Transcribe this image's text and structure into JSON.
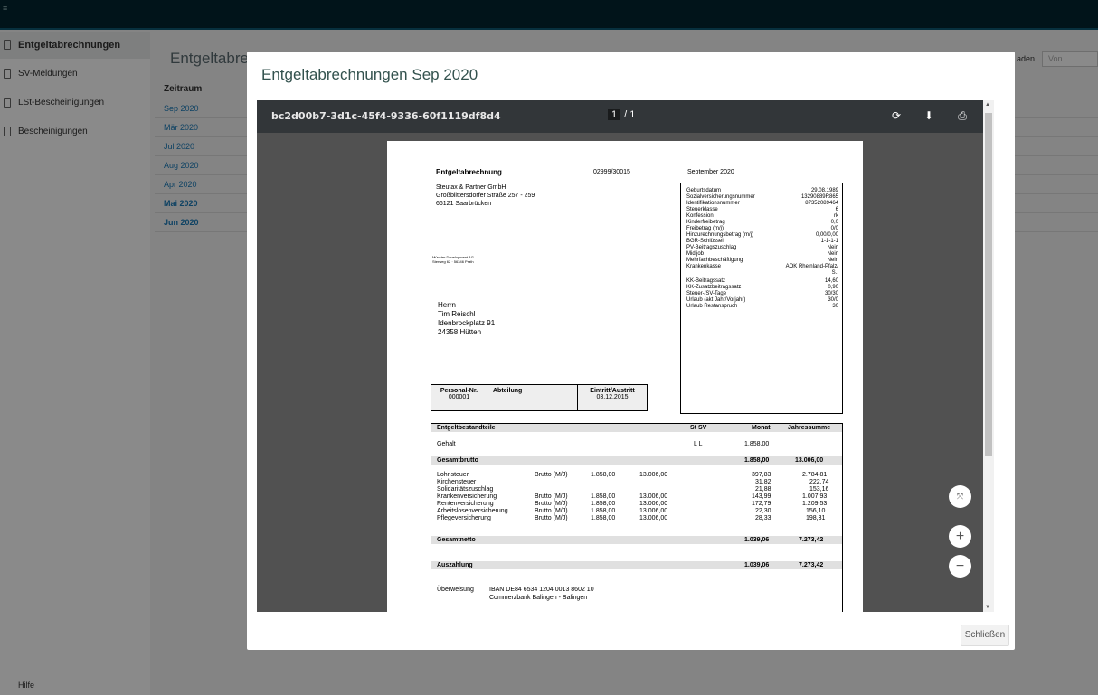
{
  "sidebar": {
    "items": [
      {
        "label": "Entgeltabrechnungen"
      },
      {
        "label": "SV-Meldungen"
      },
      {
        "label": "LSt-Bescheinigungen"
      },
      {
        "label": "Bescheinigungen"
      }
    ],
    "help_label": "Hilfe"
  },
  "main": {
    "title": "Entgeltabrec",
    "column_header": "Zeitraum",
    "rows": [
      "Sep 2020",
      "Mär 2020",
      "Jul 2020",
      "Aug 2020",
      "Apr 2020",
      "Mai 2020",
      "Jun 2020"
    ],
    "filter_label": "aden",
    "filter_placeholder": "Von"
  },
  "modal": {
    "title": "Entgeltabrechnungen Sep 2020",
    "close_label": "Schließen",
    "viewer": {
      "filename": "bc2d00b7-3d1c-45f4-9336-60f1119df8d4",
      "page_current": "1",
      "page_total": "/ 1"
    }
  },
  "document": {
    "title": "Entgeltabrechnung",
    "number": "02999/30015",
    "period": "September 2020",
    "employer": [
      "Steutax & Partner GmbH",
      "Großblittersdorfer Straße 257 - 259",
      "66121 Saarbrücken"
    ],
    "sender": [
      "Münster Development AG",
      "Sterweg 62 · 56346 Prath"
    ],
    "recipient": [
      "Herrn",
      "Tim Reischl",
      "Idenbrockplatz 91",
      "24358 Hütten"
    ],
    "info": [
      {
        "k": "Geburtsdatum",
        "v": "29.08.1989"
      },
      {
        "k": "Sozialversicherungsnummer",
        "v": "13290889R865"
      },
      {
        "k": "Identifikationsnummer",
        "v": "87352089464"
      },
      {
        "k": "Steuerklasse",
        "v": "6"
      },
      {
        "k": "Konfession",
        "v": "rk"
      },
      {
        "k": "Kinderfreibetrag",
        "v": "0,0"
      },
      {
        "k": "Freibetrag (m/j)",
        "v": "0/0"
      },
      {
        "k": "Hinzurechnungsbetrag (m/j)",
        "v": "0,00/0,00"
      },
      {
        "k": "BGR-Schlüssel",
        "v": "1-1-1-1"
      },
      {
        "k": "PV-Beitragszuschlag",
        "v": "Nein"
      },
      {
        "k": "Midijob",
        "v": "Nein"
      },
      {
        "k": "Mehrfachbeschäftigung",
        "v": "Nein"
      },
      {
        "k": "Krankenkasse",
        "v": "AOK Rheinland-Pfalz/"
      },
      {
        "k": "",
        "v": "S.."
      },
      {
        "k": "KK-Beitragssatz",
        "v": "14,60"
      },
      {
        "k": "KK-Zusatzbeitragssatz",
        "v": "0,90"
      },
      {
        "k": "Steuer-/SV-Tage",
        "v": "30/30"
      },
      {
        "k": "Urlaub (akt Jahr/Vorjahr)",
        "v": "30/0"
      },
      {
        "k": "Urlaub Restanspruch",
        "v": "30"
      }
    ],
    "personal": {
      "h1": "Personal-Nr.",
      "v1": "000001",
      "h2": "Abteilung",
      "h3": "Eintritt/Austritt",
      "v3": "03.12.2015"
    },
    "earnings_header": {
      "label": "Entgeltbestandteile",
      "stsv": "St SV",
      "monat": "Monat",
      "jahr": "Jahressumme"
    },
    "gehalt": {
      "label": "Gehalt",
      "stsv": "L   L",
      "monat": "1.858,00"
    },
    "brutto": {
      "label": "Gesamtbrutto",
      "monat": "1.858,00",
      "jahr": "13.006,00"
    },
    "deductions": [
      {
        "label": "Lohnsteuer",
        "basis": "Brutto (M/J)",
        "bm": "1.858,00",
        "bj": "13.006,00",
        "monat": "397,83",
        "jahr": "2.784,81"
      },
      {
        "label": "Kirchensteuer",
        "basis": "",
        "bm": "",
        "bj": "",
        "monat": "31,82",
        "jahr": "222,74"
      },
      {
        "label": "Solidaritätszuschlag",
        "basis": "",
        "bm": "",
        "bj": "",
        "monat": "21,88",
        "jahr": "153,16"
      },
      {
        "label": "Krankenversicherung",
        "basis": "Brutto (M/J)",
        "bm": "1.858,00",
        "bj": "13.006,00",
        "monat": "143,99",
        "jahr": "1.007,93"
      },
      {
        "label": "Rentenversicherung",
        "basis": "Brutto (M/J)",
        "bm": "1.858,00",
        "bj": "13.006,00",
        "monat": "172,79",
        "jahr": "1.209,53"
      },
      {
        "label": "Arbeitslosenversicherung",
        "basis": "Brutto (M/J)",
        "bm": "1.858,00",
        "bj": "13.006,00",
        "monat": "22,30",
        "jahr": "156,10"
      },
      {
        "label": "Pflegeversicherung",
        "basis": "Brutto (M/J)",
        "bm": "1.858,00",
        "bj": "13.006,00",
        "monat": "28,33",
        "jahr": "198,31"
      }
    ],
    "netto": {
      "label": "Gesamtnetto",
      "monat": "1.039,06",
      "jahr": "7.273,42"
    },
    "auszahlung": {
      "label": "Auszahlung",
      "monat": "1.039,06",
      "jahr": "7.273,42"
    },
    "transfer": {
      "label": "Überweisung",
      "iban": "IBAN DE84 6534 1204 0013 8602 10",
      "bank": "Commerzbank Balingen - Balingen"
    }
  }
}
